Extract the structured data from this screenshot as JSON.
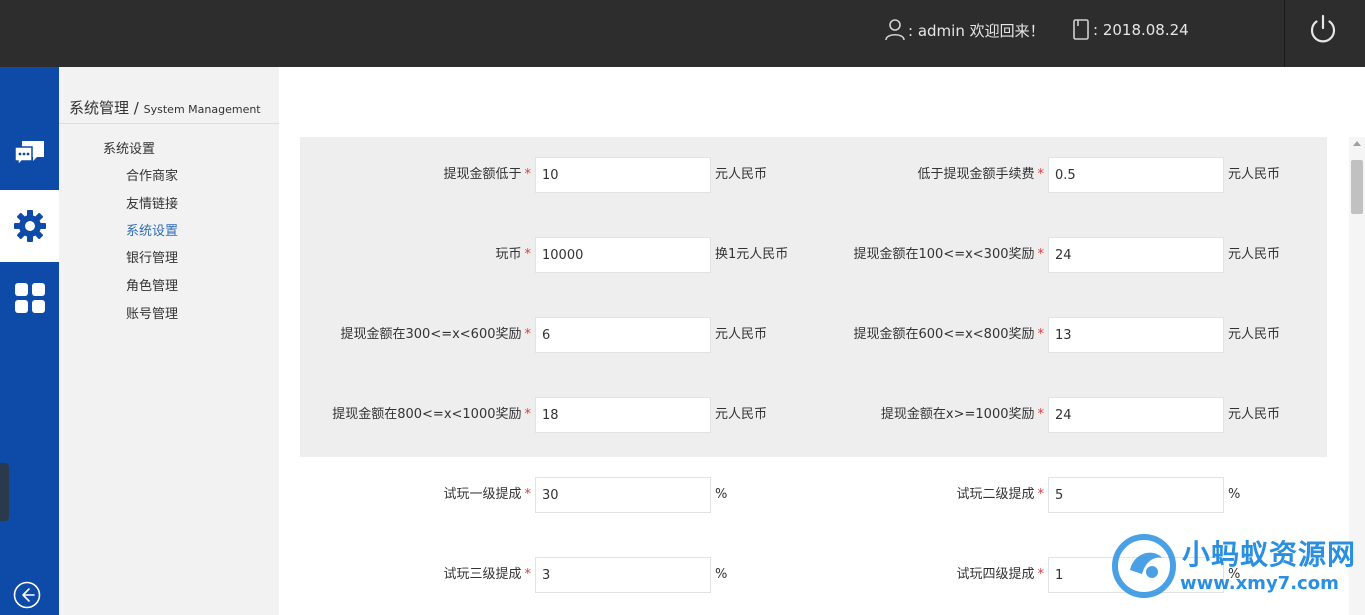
{
  "header": {
    "user_text": ": admin 欢迎回来！",
    "date_text": ": 2018.08.24"
  },
  "rail": {
    "items": [
      {
        "icon": "chat-bubbles-icon",
        "active": false
      },
      {
        "icon": "gear-icon",
        "active": true
      },
      {
        "icon": "grid-icon",
        "active": false
      }
    ],
    "accent": "#0e4ba8"
  },
  "subnav": {
    "title": "系统管理",
    "title_sep": "/",
    "title_en": "System Management",
    "group": "系统设置",
    "items": [
      "合作商家",
      "友情链接",
      "系统设置",
      "银行管理",
      "角色管理",
      "账号管理"
    ],
    "active_index": 2
  },
  "form": {
    "rows": [
      {
        "left": {
          "label": "提现金额低于",
          "value": "10",
          "unit": "元人民币"
        },
        "right": {
          "label": "低于提现金额手续费",
          "value": "0.5",
          "unit": "元人民币"
        }
      },
      {
        "left": {
          "label": "玩币",
          "value": "10000",
          "unit": "换1元人民币"
        },
        "right": {
          "label": "提现金额在100<=x<300奖励",
          "value": "24",
          "unit": "元人民币"
        }
      },
      {
        "left": {
          "label": "提现金额在300<=x<600奖励",
          "value": "6",
          "unit": "元人民币"
        },
        "right": {
          "label": "提现金额在600<=x<800奖励",
          "value": "13",
          "unit": "元人民币"
        }
      },
      {
        "left": {
          "label": "提现金额在800<=x<1000奖励",
          "value": "18",
          "unit": "元人民币"
        },
        "right": {
          "label": "提现金额在x>=1000奖励",
          "value": "24",
          "unit": "元人民币"
        }
      },
      {
        "left": {
          "label": "试玩一级提成",
          "value": "30",
          "unit": "%"
        },
        "right": {
          "label": "试玩二级提成",
          "value": "5",
          "unit": "%"
        }
      },
      {
        "left": {
          "label": "试玩三级提成",
          "value": "3",
          "unit": "%"
        },
        "right": {
          "label": "试玩四级提成",
          "value": "1",
          "unit": "%"
        }
      }
    ],
    "required_mark": "*"
  },
  "watermark": {
    "title": "小蚂蚁资源网",
    "url": "www.xmy7.com"
  }
}
